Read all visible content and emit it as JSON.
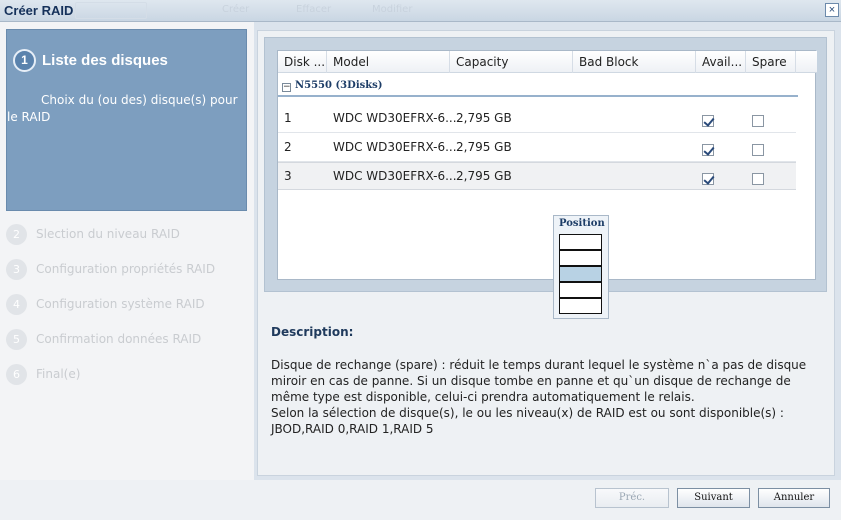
{
  "window": {
    "title": "Créer RAID",
    "close_glyph": "×",
    "ghost_toolbar": [
      "Créer",
      "Effacer",
      "Modifier"
    ]
  },
  "wizard": {
    "active_step": {
      "number": "1",
      "title": "Liste des disques",
      "description": "Choix du (ou des) disque(s) pour le RAID"
    },
    "steps": [
      {
        "number": "2",
        "label": "Slection du niveau RAID"
      },
      {
        "number": "3",
        "label": "Configuration propriétés RAID"
      },
      {
        "number": "4",
        "label": "Configuration système RAID"
      },
      {
        "number": "5",
        "label": "Confirmation données RAID"
      },
      {
        "number": "6",
        "label": "Final(e)"
      }
    ]
  },
  "grid": {
    "columns": [
      "Disk ...",
      "Model",
      "Capacity",
      "Bad Block",
      "Avail...",
      "Spare"
    ],
    "group_toggle": "−",
    "group_label": "N5550 (3Disks)",
    "rows": [
      {
        "disk": "1",
        "model": "WDC WD30EFRX-6...",
        "capacity": "2,795 GB",
        "bad_block": "",
        "avail": true,
        "spare": false
      },
      {
        "disk": "2",
        "model": "WDC WD30EFRX-6...",
        "capacity": "2,795 GB",
        "bad_block": "",
        "avail": true,
        "spare": false
      },
      {
        "disk": "3",
        "model": "WDC WD30EFRX-6...",
        "capacity": "2,795 GB",
        "bad_block": "",
        "avail": true,
        "spare": false
      }
    ]
  },
  "position_popup": {
    "title": "Position",
    "active_slot_index": 2
  },
  "description": {
    "title": "Description:",
    "line1": "Disque de rechange (spare) : réduit le temps durant lequel le système n`a pas de disque miroir en cas de panne. Si un disque tombe en panne et qu`un disque de rechange de même type est disponible, celui-ci prendra automatiquement le relais.",
    "line2": "Selon la sélection de disque(s), le ou les niveau(x) de RAID est ou sont disponible(s) :",
    "line3": "JBOD,RAID 0,RAID 1,RAID 5"
  },
  "buttons": {
    "prev": "Préc.",
    "next": "Suivant",
    "cancel": "Annuler"
  },
  "colors": {
    "active_step_bg": "#7d9ebf",
    "accent": "#1d3d67"
  }
}
